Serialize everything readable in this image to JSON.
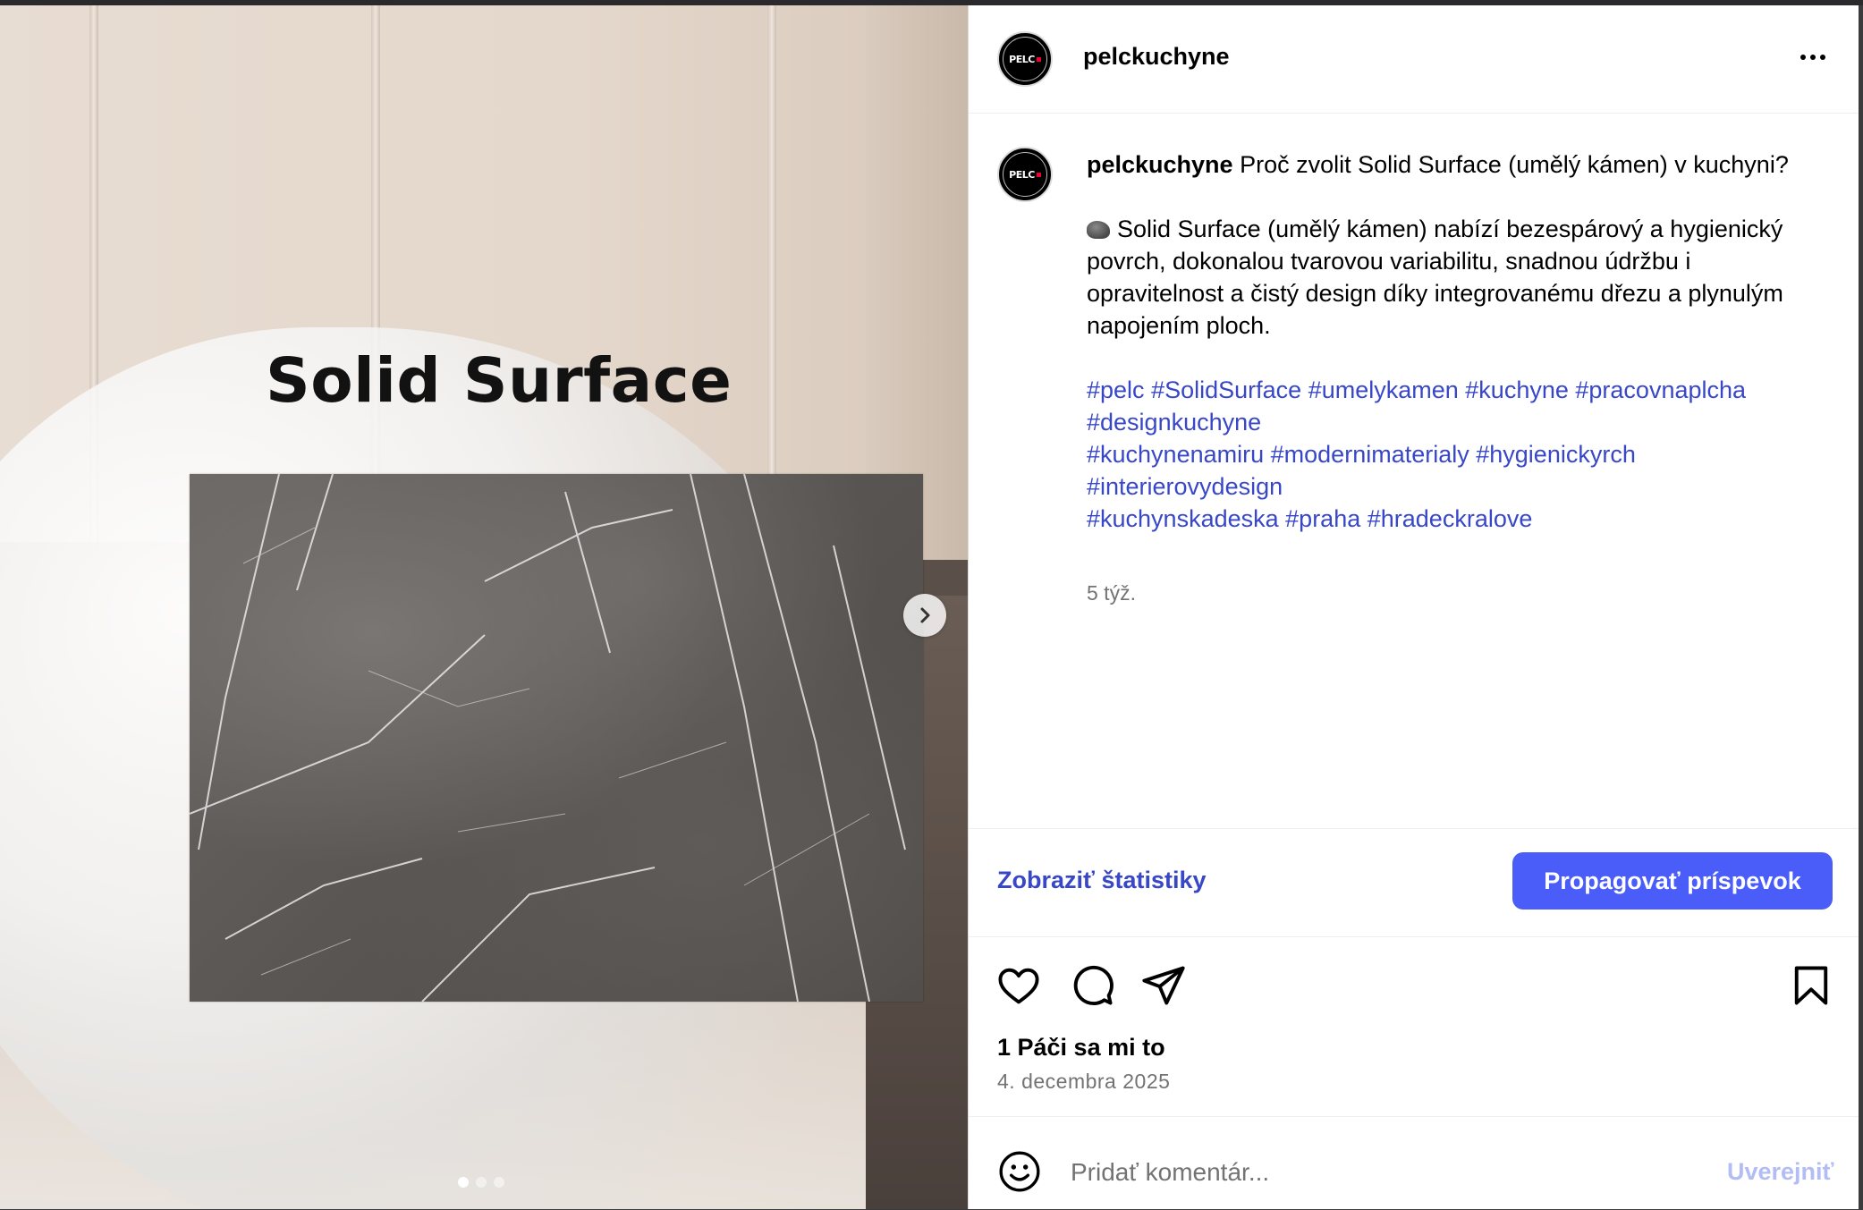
{
  "media": {
    "slide_title": "Solid Surface",
    "slide_count": 3,
    "active_slide": 1
  },
  "post": {
    "username": "pelckuchyne",
    "avatar_text": "PELC",
    "caption": {
      "first_line": "Proč zvolit Solid Surface (umělý kámen) v kuchyni?",
      "body": "Solid Surface (umělý kámen) nabízí bezespárový a hygienický povrch, dokonalou tvarovou variabilitu, snadnou údržbu i opravitelnost a čistý design díky integrovanému dřezu a plynulým napojením ploch.",
      "body_icon": "rock-emoji",
      "hashtags": [
        [
          "#pelc",
          "#SolidSurface",
          "#umelykamen",
          "#kuchyne",
          "#pracovnaplcha"
        ],
        [
          "#designkuchyne"
        ],
        [
          "#kuchynenamiru",
          "#modernimaterialy",
          "#hygienickyrch"
        ],
        [
          "#interierovydesign"
        ],
        [
          "#kuchynskadeska",
          "#praha",
          "#hradeckralove"
        ]
      ],
      "time_ago": "5 týž."
    },
    "stats_link": "Zobraziť štatistiky",
    "promote_button": "Propagovať príspevok",
    "likes": "1 Páči sa mi to",
    "date": "4. decembra 2025",
    "comment": {
      "placeholder": "Pridať komentár...",
      "value": "",
      "post_button": "Uverejniť"
    }
  },
  "icons": {
    "more": "more-horizontal-icon",
    "next": "chevron-right-icon",
    "like": "heart-icon",
    "comment": "comment-bubble-icon",
    "share": "paper-plane-icon",
    "save": "bookmark-icon",
    "emoji": "smiley-icon"
  },
  "colors": {
    "link": "#3847c7",
    "primary_button": "#4a5df9",
    "disabled_link": "#b3bdf5",
    "secondary_text": "#737373"
  }
}
